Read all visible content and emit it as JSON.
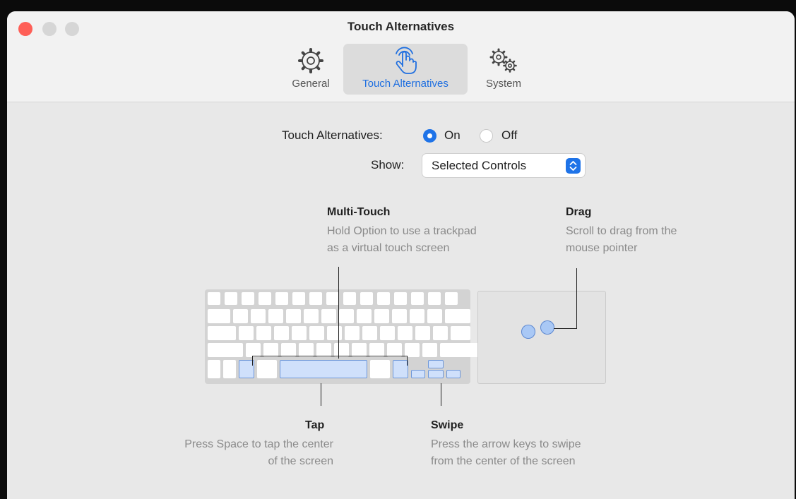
{
  "window": {
    "title": "Touch Alternatives"
  },
  "tabs": [
    {
      "label": "General",
      "icon": "gear-icon"
    },
    {
      "label": "Touch Alternatives",
      "icon": "hand-pointer-icon",
      "selected": true
    },
    {
      "label": "System",
      "icon": "gears-icon"
    }
  ],
  "settings": {
    "touch_label": "Touch Alternatives:",
    "on_label": "On",
    "off_label": "Off",
    "touch_value": "On",
    "show_label": "Show:",
    "show_value": "Selected Controls"
  },
  "captions": {
    "multitouch": {
      "title": "Multi-Touch",
      "line1": "Hold Option to use a trackpad",
      "line2": "as a virtual touch screen"
    },
    "drag": {
      "title": "Drag",
      "line1": "Scroll to drag from the",
      "line2": "mouse pointer"
    },
    "tap": {
      "title": "Tap",
      "line1": "Press Space to tap the center",
      "line2": "of the screen"
    },
    "swipe": {
      "title": "Swipe",
      "line1": "Press the arrow keys to swipe",
      "line2": "from the center of the screen"
    }
  },
  "colors": {
    "accent": "#1e73e8",
    "highlight": "#cfe0fb",
    "close": "#fe5f57"
  }
}
